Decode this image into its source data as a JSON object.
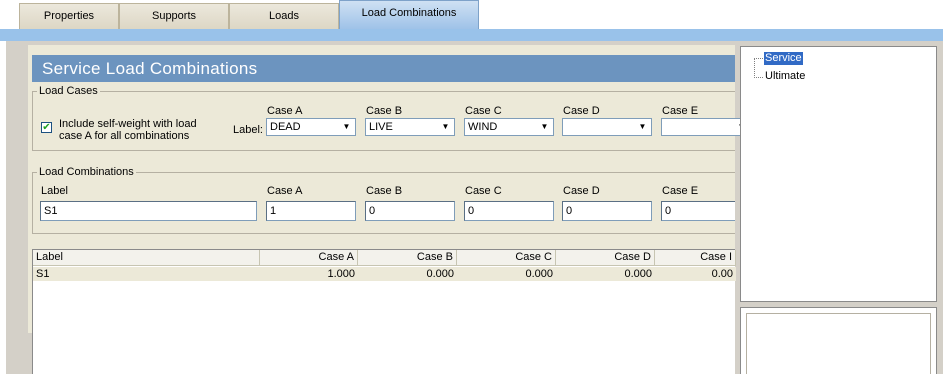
{
  "tabs": [
    {
      "label": "Properties",
      "active": false
    },
    {
      "label": "Supports",
      "active": false
    },
    {
      "label": "Loads",
      "active": false
    },
    {
      "label": "Load Combinations",
      "active": true
    }
  ],
  "banner": {
    "title": "Service Load Combinations"
  },
  "load_cases": {
    "group_title": "Load Cases",
    "self_weight_checked": true,
    "self_weight_label_line1": "Include self-weight with load",
    "self_weight_label_line2": "case A for all combinations",
    "label_prefix": "Label:",
    "columns": [
      {
        "header": "Case A",
        "value": "DEAD"
      },
      {
        "header": "Case B",
        "value": "LIVE"
      },
      {
        "header": "Case C",
        "value": "WIND"
      },
      {
        "header": "Case D",
        "value": ""
      },
      {
        "header": "Case E",
        "value": ""
      }
    ]
  },
  "load_combinations": {
    "group_title": "Load Combinations",
    "label_header": "Label",
    "label_value": "S1",
    "columns": [
      {
        "header": "Case A",
        "value": "1"
      },
      {
        "header": "Case B",
        "value": "0"
      },
      {
        "header": "Case C",
        "value": "0"
      },
      {
        "header": "Case D",
        "value": "0"
      },
      {
        "header": "Case E",
        "value": "0"
      }
    ]
  },
  "table": {
    "headers": [
      "Label",
      "Case A",
      "Case B",
      "Case C",
      "Case D",
      "Case I"
    ],
    "rows": [
      [
        "S1",
        "1.000",
        "0.000",
        "0.000",
        "0.000",
        "0.00"
      ]
    ]
  },
  "tree": {
    "items": [
      {
        "label": "Service",
        "selected": true
      },
      {
        "label": "Ultimate",
        "selected": false
      }
    ]
  },
  "icons": {
    "check": "check-mark-icon",
    "dropdown": "chevron-down-icon"
  },
  "colors": {
    "active_tab": "#9dc1e8",
    "banner": "#6c94bf",
    "selection": "#316ac5"
  }
}
